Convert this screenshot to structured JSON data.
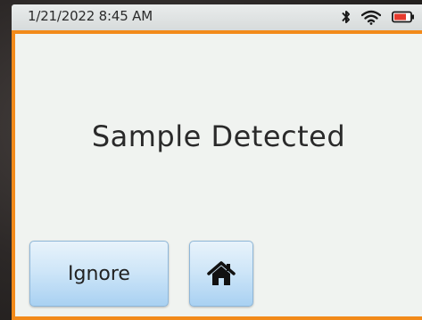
{
  "status": {
    "datetime": "1/21/2022 8:45 AM",
    "icons": [
      "bluetooth-icon",
      "wifi-icon",
      "battery-low-icon"
    ],
    "battery_color": "#e63b2e"
  },
  "screen": {
    "message": "Sample Detected",
    "accent_color": "#f28a1a"
  },
  "buttons": {
    "ignore_label": "Ignore",
    "home_icon": "home-icon"
  }
}
